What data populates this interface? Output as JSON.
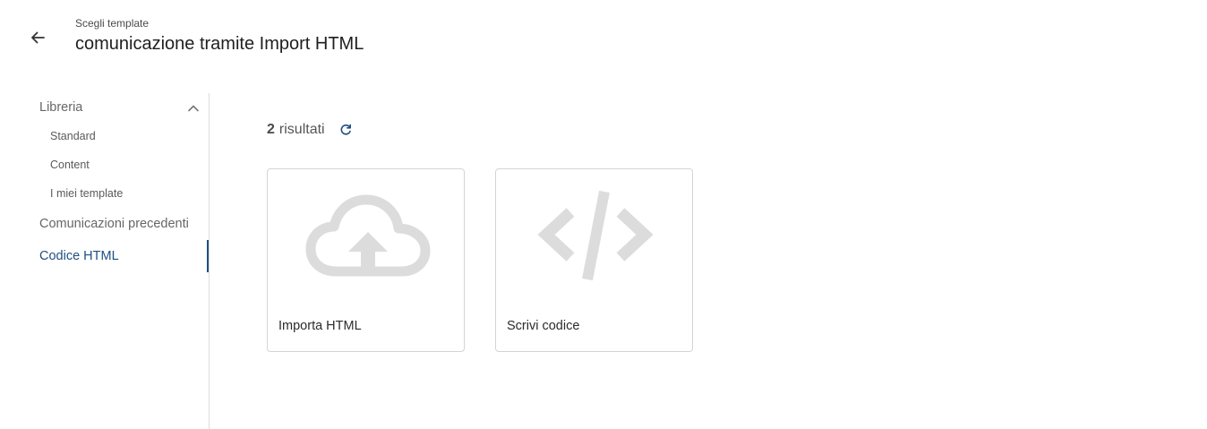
{
  "header": {
    "subtitle": "Scegli template",
    "title": "comunicazione tramite Import HTML"
  },
  "sidebar": {
    "sections": [
      {
        "label": "Libreria",
        "expanded": true,
        "items": [
          {
            "label": "Standard"
          },
          {
            "label": "Content"
          },
          {
            "label": "I miei template"
          }
        ]
      },
      {
        "label": "Comunicazioni precedenti"
      },
      {
        "label": "Codice HTML",
        "active": true
      }
    ]
  },
  "results": {
    "count": "2",
    "label": "risultati"
  },
  "cards": [
    {
      "label": "Importa HTML",
      "icon": "cloud-upload-icon"
    },
    {
      "label": "Scrivi codice",
      "icon": "code-icon"
    }
  ],
  "colors": {
    "accent": "#1f4f82",
    "icon_gray": "#dcdcdc",
    "border": "#d4d4d4"
  }
}
